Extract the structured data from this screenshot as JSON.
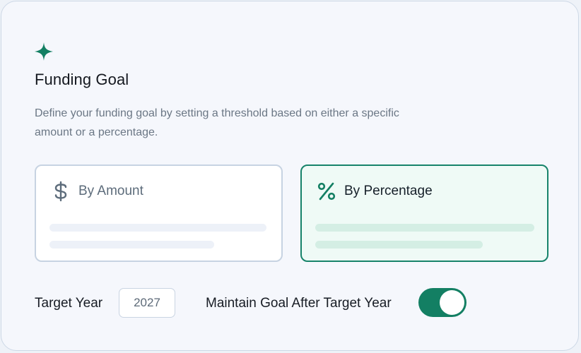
{
  "colors": {
    "accent": "#137f63",
    "selected_background": "#effaf6",
    "card_background": "#f5f7fc"
  },
  "header": {
    "icon": "sparkle-icon",
    "title": "Funding Goal",
    "description": "Define your funding goal by setting a threshold based on either a specific amount or a percentage."
  },
  "options": [
    {
      "id": "amount",
      "icon": "dollar-icon",
      "label": "By Amount",
      "selected": false
    },
    {
      "id": "percentage",
      "icon": "percent-icon",
      "label": "By Percentage",
      "selected": true
    }
  ],
  "target_year": {
    "label": "Target Year",
    "value": "2027"
  },
  "maintain_goal": {
    "label": "Maintain Goal After Target Year",
    "enabled": true
  }
}
